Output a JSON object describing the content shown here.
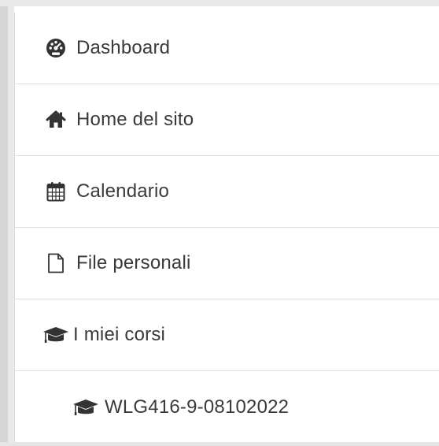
{
  "nav": {
    "items": [
      {
        "label": "Dashboard",
        "icon": "dashboard-icon"
      },
      {
        "label": "Home del sito",
        "icon": "home-icon"
      },
      {
        "label": "Calendario",
        "icon": "calendar-icon"
      },
      {
        "label": "File personali",
        "icon": "file-icon"
      },
      {
        "label": "I miei corsi",
        "icon": "graduation-cap-icon"
      },
      {
        "label": "WLG416-9-08102022",
        "icon": "graduation-cap-icon"
      }
    ]
  },
  "colors": {
    "text": "#3a3a3a",
    "icon": "#333333",
    "divider": "#dedede",
    "frame": "#d6d6d6"
  }
}
